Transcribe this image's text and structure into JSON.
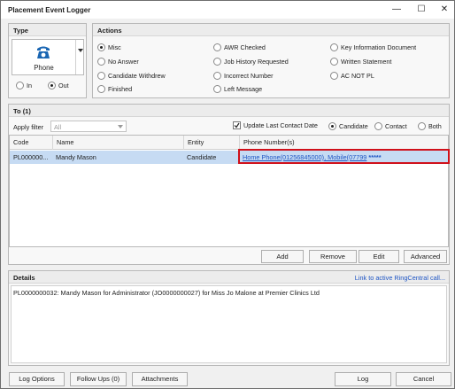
{
  "window": {
    "title": "Placement Event Logger",
    "minimize": "—",
    "maximize": "☐",
    "close": "✕"
  },
  "type_panel": {
    "title": "Type",
    "selected_type": "Phone",
    "direction": [
      {
        "label": "In",
        "selected": false
      },
      {
        "label": "Out",
        "selected": true
      }
    ]
  },
  "actions_panel": {
    "title": "Actions",
    "options": [
      {
        "label": "Misc",
        "selected": true
      },
      {
        "label": "No Answer",
        "selected": false
      },
      {
        "label": "Candidate Withdrew",
        "selected": false
      },
      {
        "label": "Finished",
        "selected": false
      },
      {
        "label": "AWR Checked",
        "selected": false
      },
      {
        "label": "Job History Requested",
        "selected": false
      },
      {
        "label": "Incorrect Number",
        "selected": false
      },
      {
        "label": "Left Message",
        "selected": false
      },
      {
        "label": "Key Information Document",
        "selected": false
      },
      {
        "label": "Written Statement",
        "selected": false
      },
      {
        "label": "AC NOT PL",
        "selected": false
      }
    ]
  },
  "to_panel": {
    "title": "To (1)",
    "apply_filter_label": "Apply filter",
    "filter_value": "All",
    "update_last_contact_label": "Update Last Contact Date",
    "update_last_contact_checked": true,
    "target": [
      {
        "label": "Candidate",
        "selected": true
      },
      {
        "label": "Contact",
        "selected": false
      },
      {
        "label": "Both",
        "selected": false
      }
    ],
    "columns": [
      "Code",
      "Name",
      "Entity",
      "Phone Number(s)"
    ],
    "rows": [
      {
        "code": "PL000000...",
        "name": "Mandy Mason",
        "entity": "Candidate",
        "phone": "Home Phone(01256845000), Mobile(07799",
        "masked": " *****"
      }
    ],
    "buttons": {
      "add": "Add",
      "remove": "Remove",
      "edit": "Edit",
      "advanced": "Advanced"
    }
  },
  "details_panel": {
    "title": "Details",
    "link": "Link to active RingCentral call...",
    "text": "PL0000000032: Mandy Mason for Administrator (JO0000000027) for Miss Jo Malone at Premier Clinics Ltd"
  },
  "footer": {
    "log_options": "Log Options",
    "follow_ups": "Follow Ups (0)",
    "attachments": "Attachments",
    "log": "Log",
    "cancel": "Cancel"
  },
  "colors": {
    "highlight_border": "#d0101a",
    "row_selected": "#c6dbf3",
    "link": "#1f56c4",
    "phone_icon": "#1a66b3"
  }
}
